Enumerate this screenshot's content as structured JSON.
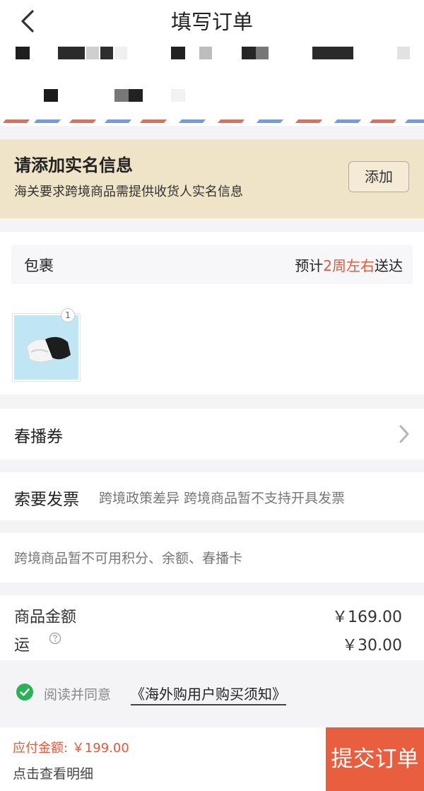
{
  "header": {
    "title": "填写订单"
  },
  "realname": {
    "title": "请添加实名信息",
    "subtitle": "海关要求跨境商品需提供收货人实名信息",
    "add_label": "添加"
  },
  "package": {
    "label": "包裹",
    "eta_prefix": "预计",
    "eta_highlight": "2周左右",
    "eta_suffix": "送达",
    "qty": "1"
  },
  "coupon": {
    "label": "春播券"
  },
  "invoice": {
    "label": "索要发票",
    "note": "跨境政策差异 跨境商品暂不支持开具发票"
  },
  "points": {
    "note": "跨境商品暂不可用积分、余额、春播卡"
  },
  "amounts": {
    "goods_label": "商品金额",
    "goods_value": "￥169.00",
    "ship_label": "运",
    "ship_value": "￥30.00"
  },
  "agreement": {
    "text": "阅读并同意",
    "link": "《海外购用户购买须知》"
  },
  "footer": {
    "pay_amount": "应付金额: ￥199.00",
    "detail": "点击查看明细",
    "submit": "提交订单"
  },
  "colors": {
    "accent": "#e85e3e",
    "banner": "#efe3c8",
    "check": "#2bb257"
  },
  "icons": [
    "back-arrow-icon",
    "chevron-right-icon",
    "help-circle-icon",
    "check-circle-icon"
  ]
}
